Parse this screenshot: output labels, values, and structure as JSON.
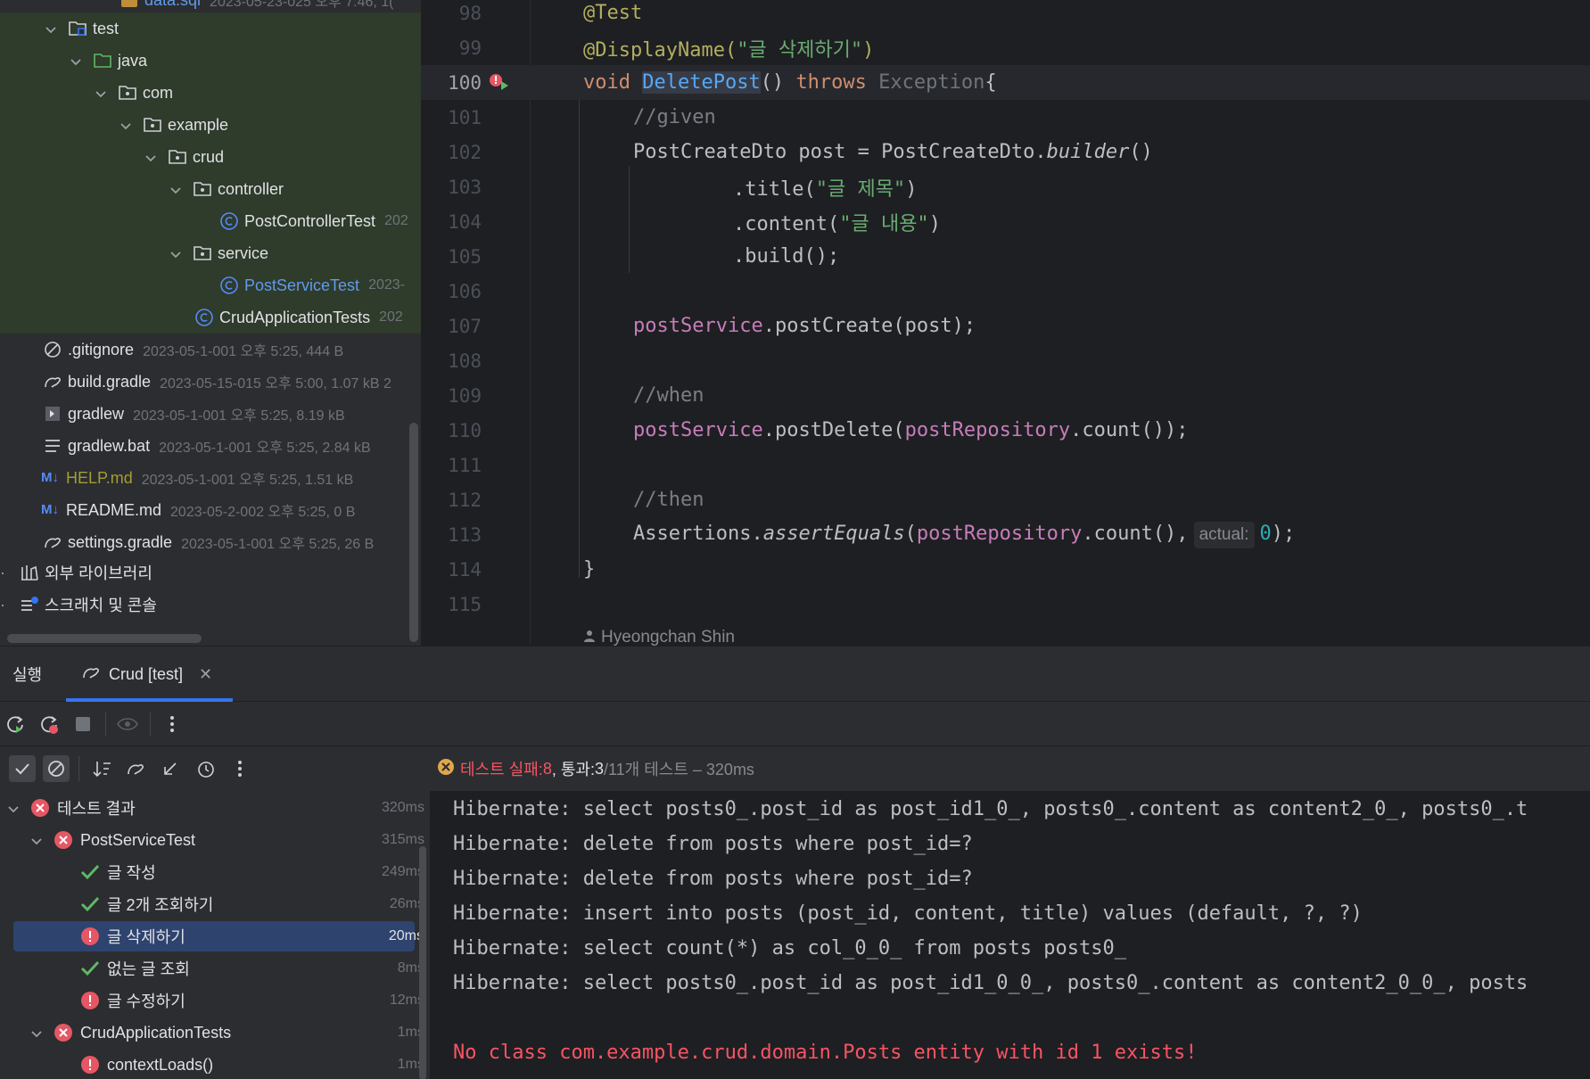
{
  "project_tree": {
    "rows": [
      {
        "name": "data.sql",
        "meta": "2023-05-23-025 오후 7:46, 1("
      },
      {
        "name": "test"
      },
      {
        "name": "java"
      },
      {
        "name": "com"
      },
      {
        "name": "example"
      },
      {
        "name": "crud"
      },
      {
        "name": "controller"
      },
      {
        "name": "PostControllerTest",
        "meta": "202"
      },
      {
        "name": "service"
      },
      {
        "name": "PostServiceTest",
        "meta": "2023-"
      },
      {
        "name": "CrudApplicationTests",
        "meta": "202"
      },
      {
        "name": ".gitignore",
        "meta": "2023-05-1-001 오후 5:25, 444 B"
      },
      {
        "name": "build.gradle",
        "meta": "2023-05-15-015 오후 5:00, 1.07 kB 2"
      },
      {
        "name": "gradlew",
        "meta": "2023-05-1-001 오후 5:25, 8.19 kB"
      },
      {
        "name": "gradlew.bat",
        "meta": "2023-05-1-001 오후 5:25, 2.84 kB"
      },
      {
        "name": "HELP.md",
        "meta": "2023-05-1-001 오후 5:25, 1.51 kB"
      },
      {
        "name": "README.md",
        "meta": "2023-05-2-002 오후 5:25, 0 B"
      },
      {
        "name": "settings.gradle",
        "meta": "2023-05-1-001 오후 5:25, 26 B"
      },
      {
        "name": "외부 라이브러리"
      },
      {
        "name": "스크래치 및 콘솔"
      }
    ]
  },
  "editor": {
    "lines": [
      "98",
      "99",
      "100",
      "101",
      "102",
      "103",
      "104",
      "105",
      "106",
      "107",
      "108",
      "109",
      "110",
      "111",
      "112",
      "113",
      "114",
      "115"
    ],
    "tokens": {
      "test_ann": "@Test",
      "display_ann": "@DisplayName(",
      "display_str": "\"글 삭제하기\"",
      "close_paren": ")",
      "void": "void ",
      "method": "DeletePost",
      "parens": "() ",
      "throws": "throws ",
      "exception": "Exception",
      "brace_open": "{",
      "given": "//given",
      "dto_line": "PostCreateDto post = PostCreateDto.",
      "builder": "builder",
      "call_end": "()",
      "title_call": ".title(",
      "title_str": "\"글 제목\"",
      "content_call": ".content(",
      "content_str": "\"글 내용\"",
      "build": ".build();",
      "post_service": "postService",
      "create_call": ".postCreate(post);",
      "when": "//when",
      "delete_call": ".postDelete(",
      "post_repository": "postRepository",
      "count_end": ".count());",
      "then": "//then",
      "assertions": "Assertions.",
      "assert_equals": "assertEquals",
      "open_paren": "(",
      "count_comma": ".count(),",
      "hint_actual": "actual:",
      "zero": "0",
      "end_paren": ");",
      "brace_close": "}"
    },
    "author": "Hyeongchan Shin"
  },
  "run": {
    "tab_run": "실행",
    "tab_crud": "Crud [test]",
    "status": {
      "label": "테스트 실패: ",
      "failed": "8",
      "passed_label": ", 통과: ",
      "passed": "3",
      "total": " /11개 테스트 – 320ms"
    },
    "tests": [
      {
        "name": "테스트 결과",
        "time": "320ms"
      },
      {
        "name": "PostServiceTest",
        "time": "315ms"
      },
      {
        "name": "글 작성",
        "time": "249ms"
      },
      {
        "name": "글 2개 조회하기",
        "time": "26ms"
      },
      {
        "name": "글 삭제하기",
        "time": "20ms"
      },
      {
        "name": "없는 글 조회",
        "time": "8ms"
      },
      {
        "name": "글 수정하기",
        "time": "12ms"
      },
      {
        "name": "CrudApplicationTests",
        "time": "1ms"
      },
      {
        "name": "contextLoads()",
        "time": "1ms"
      }
    ],
    "console": [
      "Hibernate: select posts0_.post_id as post_id1_0_, posts0_.content as content2_0_, posts0_.t",
      "Hibernate: delete from posts where post_id=?",
      "Hibernate: delete from posts where post_id=?",
      "Hibernate: insert into posts (post_id, content, title) values (default, ?, ?)",
      "Hibernate: select count(*) as col_0_0_ from posts posts0_",
      "Hibernate: select posts0_.post_id as post_id1_0_0_, posts0_.content as content2_0_0_, posts",
      "No class com.example.crud.domain.Posts entity with id 1 exists!"
    ]
  },
  "colors": {
    "fail": "#f75464",
    "pass": "#5fb865",
    "accent": "#3574f0",
    "selection": "#2e436e"
  }
}
